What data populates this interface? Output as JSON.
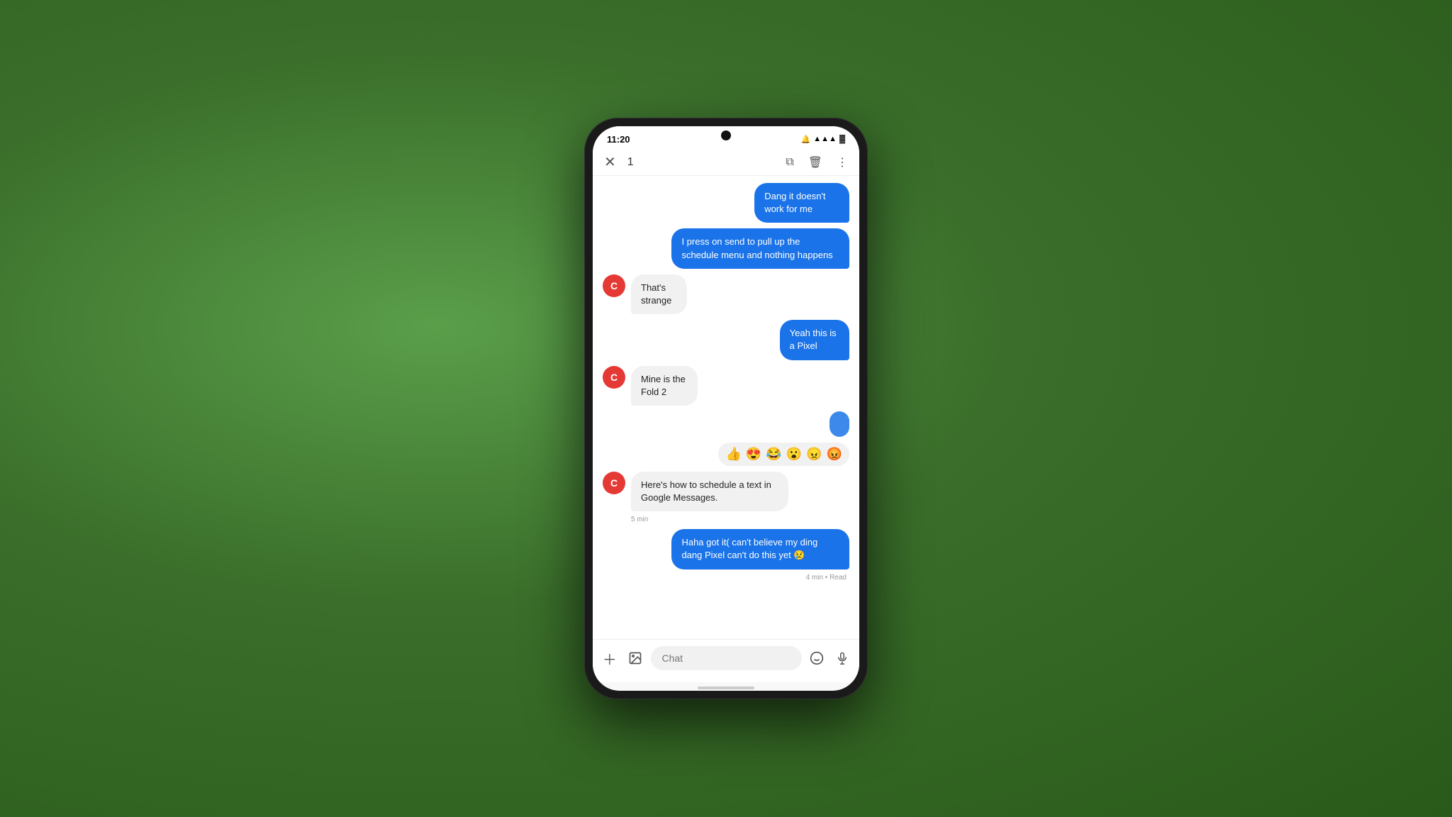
{
  "status_bar": {
    "time": "11:20",
    "icons": [
      "🔔",
      "📶",
      "🔋"
    ]
  },
  "action_bar": {
    "close_icon": "✕",
    "count": "1",
    "copy_icon": "⧉",
    "delete_icon": "🗑",
    "more_icon": "⋮"
  },
  "messages": [
    {
      "id": "msg1",
      "type": "sent",
      "text": "Dang it doesn't work for me",
      "timestamp": ""
    },
    {
      "id": "msg2",
      "type": "sent",
      "text": "I press on send to pull up the schedule menu and nothing happens",
      "timestamp": ""
    },
    {
      "id": "msg3",
      "type": "received",
      "text": "That's strange",
      "avatar": "C",
      "timestamp": ""
    },
    {
      "id": "msg4",
      "type": "sent",
      "text": "Yeah this is a Pixel",
      "timestamp": ""
    },
    {
      "id": "msg5",
      "type": "received",
      "text": "Mine is the Fold 2",
      "avatar": "C",
      "timestamp": ""
    },
    {
      "id": "msg6",
      "type": "reactions",
      "emojis": [
        "👍",
        "😍",
        "😂",
        "😮",
        "😠",
        "😡"
      ],
      "timestamp": ""
    },
    {
      "id": "msg7",
      "type": "received",
      "text": "Here's how to schedule a text in Google Messages.",
      "avatar": "C",
      "timestamp": "5 min"
    },
    {
      "id": "msg8",
      "type": "sent",
      "text": "Haha got it( can't believe my ding dang Pixel can't do this yet 😢",
      "timestamp": "4 min • Read"
    }
  ],
  "input_bar": {
    "add_icon": "+",
    "image_icon": "🖼",
    "placeholder": "Chat",
    "emoji_icon": "😊",
    "voice_icon": "🎤"
  }
}
